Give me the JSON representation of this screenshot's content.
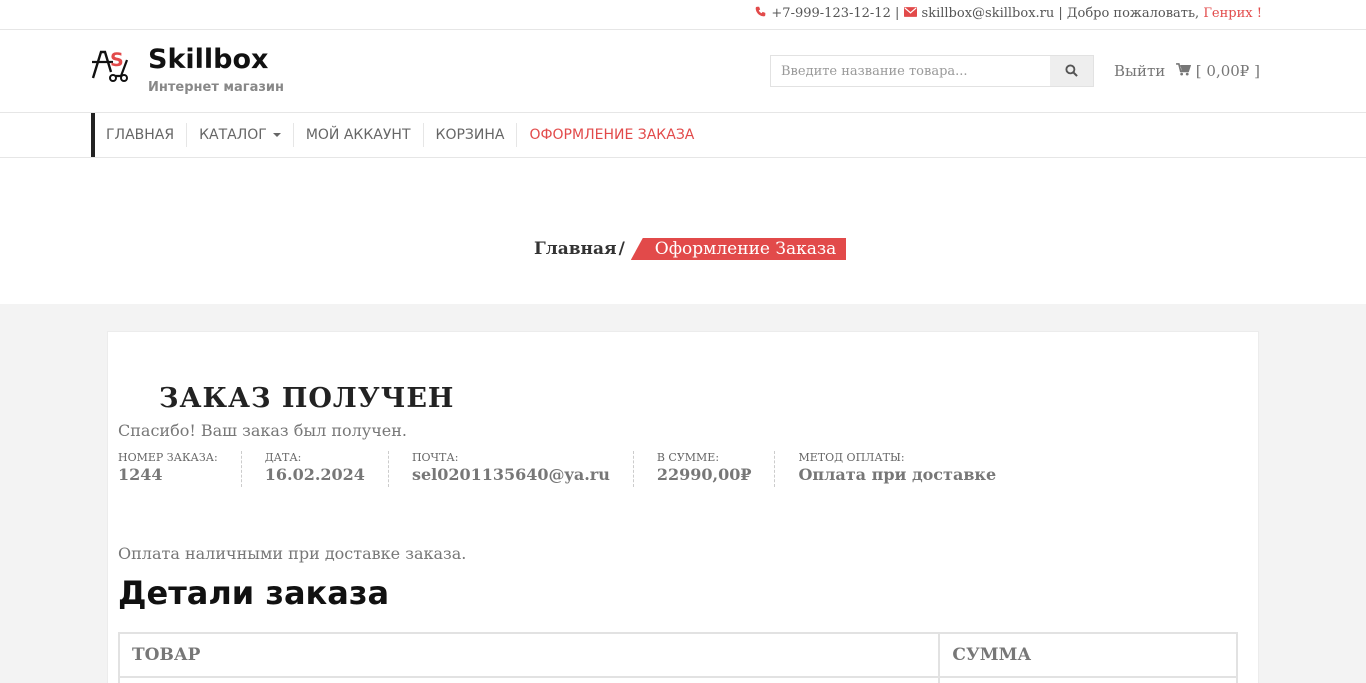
{
  "topbar": {
    "phone": "+7-999-123-12-12",
    "separator": "|",
    "email": "skillbox@skillbox.ru",
    "welcome": "| Добро пожаловать,",
    "user_name": "Генрих",
    "exclaim": "!"
  },
  "header": {
    "logo_title": "Skillbox",
    "logo_subtitle": "Интернет магазин",
    "search_placeholder": "Введите название товара...",
    "logout_label": "Выйти",
    "cart_label": "[ 0,00₽ ]"
  },
  "nav": {
    "items": [
      {
        "label": "ГЛАВНАЯ"
      },
      {
        "label": "КАТАЛОГ"
      },
      {
        "label": "МОЙ АККАУНТ"
      },
      {
        "label": "КОРЗИНА"
      },
      {
        "label": "ОФОРМЛЕНИЕ ЗАКАЗА"
      }
    ]
  },
  "breadcrumb": {
    "home": "Главная",
    "separator": "/",
    "current": "Оформление Заказа"
  },
  "order": {
    "title": "ЗАКАЗ ПОЛУЧЕН",
    "thanks": "Спасибо! Ваш заказ был получен.",
    "overview": [
      {
        "label": "НОМЕР ЗАКАЗА:",
        "value": "1244"
      },
      {
        "label": "ДАТА:",
        "value": "16.02.2024"
      },
      {
        "label": "ПОЧТА:",
        "value": "sel0201135640@ya.ru"
      },
      {
        "label": "В СУММЕ:",
        "value": "22990,00₽"
      },
      {
        "label": "МЕТОД ОПЛАТЫ:",
        "value": "Оплата при доставке"
      }
    ],
    "payment_note": "Оплата наличными при доставке заказа.",
    "details_title": "Детали заказа",
    "table": {
      "col_product": "ТОВАР",
      "col_total": "СУММА"
    }
  },
  "colors": {
    "accent": "#e24a4a",
    "nav_bar": "#222222"
  }
}
